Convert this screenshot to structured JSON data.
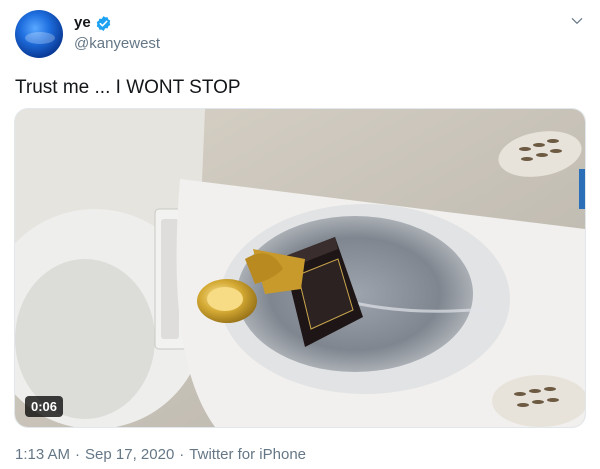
{
  "user": {
    "display_name": "ye",
    "handle": "@kanyewest",
    "verified_icon": "verified-badge-icon",
    "avatar_icon": "blue-globe-avatar"
  },
  "tweet": {
    "text": "Trust me ... I WONT STOP"
  },
  "media": {
    "type": "video",
    "duration": "0:06"
  },
  "meta": {
    "time": "1:13 AM",
    "separator1": "·",
    "date": "Sep 17, 2020",
    "separator2": "·",
    "source": "Twitter for iPhone"
  },
  "colors": {
    "verified_blue": "#1da1f2",
    "secondary_text": "#657786",
    "primary_text": "#14171a"
  }
}
